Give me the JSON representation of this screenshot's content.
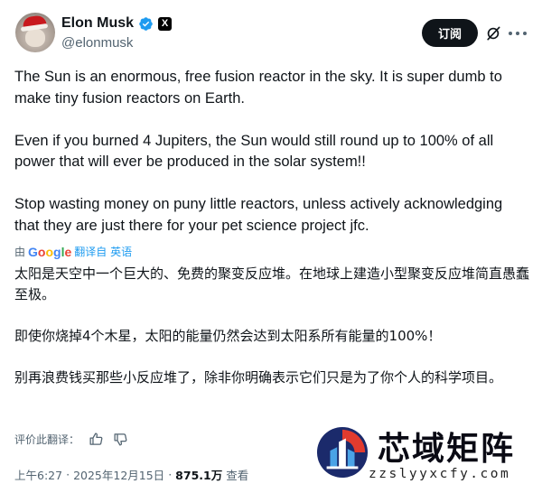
{
  "author": {
    "display_name": "Elon Musk",
    "handle": "@elonmusk",
    "x_badge": "X"
  },
  "header": {
    "subscribe_label": "订阅",
    "icons": [
      "verified-badge-icon",
      "grok-icon",
      "more-icon"
    ]
  },
  "tweet": {
    "paragraphs": [
      "The Sun is an enormous, free fusion reactor in the sky. It is super dumb to make tiny fusion reactors on Earth.",
      "Even if you burned 4 Jupiters, the Sun would still round up to 100% of all power that will ever be produced in the solar system!!",
      "Stop wasting money on puny little reactors, unless actively acknowledging that they are just there for your pet science project jfc."
    ]
  },
  "translation": {
    "by_prefix": "由",
    "google": "Google",
    "link_label": "翻译自 英语",
    "paragraphs": [
      "太阳是天空中一个巨大的、免费的聚变反应堆。在地球上建造小型聚变反应堆简直愚蠢至极。",
      "即使你烧掉4个木星，太阳的能量仍然会达到太阳系所有能量的100%！",
      "别再浪费钱买那些小反应堆了，除非你明确表示它们只是为了你个人的科学项目。"
    ],
    "rate_label": "评价此翻译："
  },
  "meta": {
    "time": "上午6:27",
    "separator": "·",
    "date": "2025年12月15日",
    "views_count": "875.1万",
    "views_label": "查看"
  },
  "watermark": {
    "title": "芯域矩阵",
    "url": "zzslyyxcfy.com"
  },
  "colors": {
    "text": "#0f1419",
    "secondary": "#536471",
    "link": "#1d9bf0",
    "verified": "#1d9bf0",
    "button_bg": "#0f1419"
  }
}
